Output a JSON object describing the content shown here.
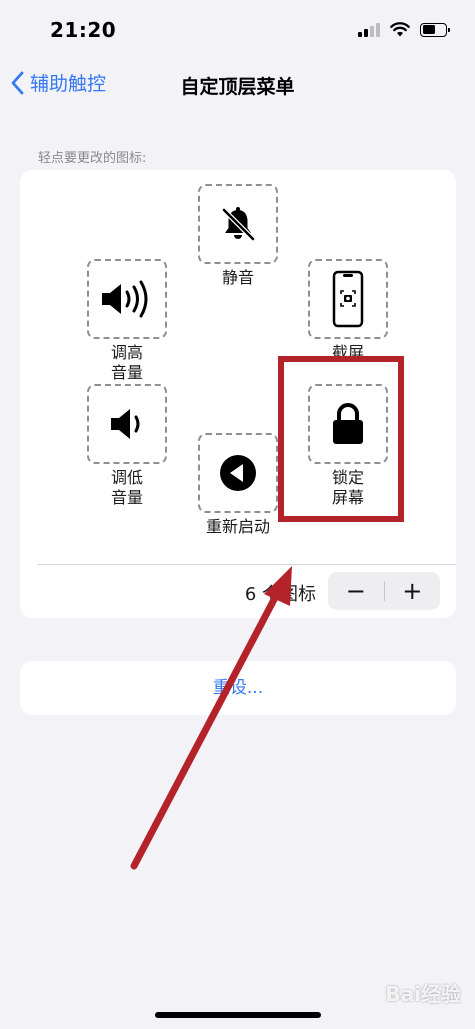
{
  "status": {
    "time": "21:20",
    "battery_level": 0.55,
    "signal_bars_active": 2,
    "signal_bars_total": 4
  },
  "nav": {
    "back_label": "辅助触控",
    "title": "自定顶层菜单"
  },
  "hint": "轻点要更改的图标:",
  "icons": {
    "mute": {
      "label": "静音"
    },
    "screenshot": {
      "label": "截屏"
    },
    "volume_up": {
      "label_line1": "调高",
      "label_line2": "音量"
    },
    "volume_down": {
      "label_line1": "调低",
      "label_line2": "音量"
    },
    "lock_screen": {
      "label_line1": "锁定",
      "label_line2": "屏幕"
    },
    "restart": {
      "label": "重新启动"
    }
  },
  "count": {
    "label": "6 个图标",
    "minus": "−",
    "plus": "+"
  },
  "reset": {
    "label": "重设..."
  },
  "annotation": {
    "highlight_color": "#b5232a"
  },
  "watermark": "Bai经验",
  "colors": {
    "accent": "#3478f6",
    "background": "#f2f2f7",
    "card": "#ffffff"
  }
}
